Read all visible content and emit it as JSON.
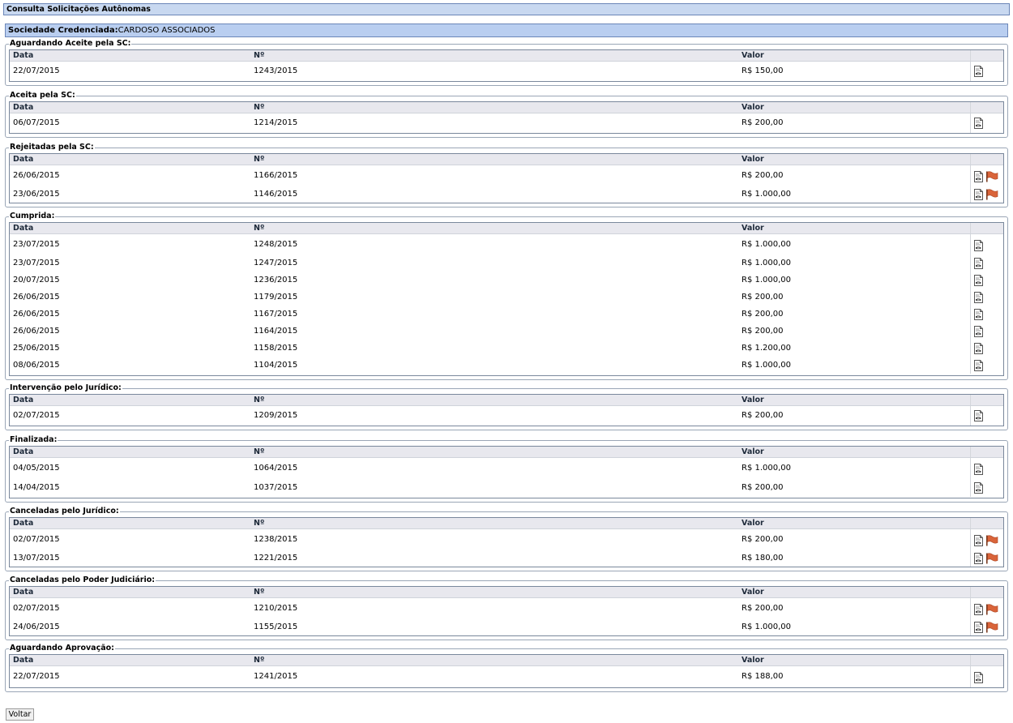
{
  "page": {
    "title": "Consulta Solicitações Autônomas",
    "sc_label": "Sociedade Credenciada:",
    "sc_value": "CARDOSO ASSOCIADOS",
    "back_button": "Voltar"
  },
  "columns": {
    "data": "Data",
    "numero": "Nº",
    "valor": "Valor"
  },
  "sections": [
    {
      "title": "Aguardando Aceite pela SC:",
      "rows": [
        {
          "data": "22/07/2015",
          "numero": "1243/2015",
          "valor": "R$ 150,00",
          "flag": false
        }
      ]
    },
    {
      "title": "Aceita pela SC:",
      "rows": [
        {
          "data": "06/07/2015",
          "numero": "1214/2015",
          "valor": "R$ 200,00",
          "flag": false
        }
      ]
    },
    {
      "title": "Rejeitadas pela SC:",
      "rows": [
        {
          "data": "26/06/2015",
          "numero": "1166/2015",
          "valor": "R$ 200,00",
          "flag": true
        },
        {
          "data": "23/06/2015",
          "numero": "1146/2015",
          "valor": "R$ 1.000,00",
          "flag": true
        }
      ]
    },
    {
      "title": "Cumprida:",
      "rows": [
        {
          "data": "23/07/2015",
          "numero": "1248/2015",
          "valor": "R$ 1.000,00",
          "flag": false
        },
        {
          "data": "23/07/2015",
          "numero": "1247/2015",
          "valor": "R$ 1.000,00",
          "flag": false
        },
        {
          "data": "20/07/2015",
          "numero": "1236/2015",
          "valor": "R$ 1.000,00",
          "flag": false
        },
        {
          "data": "26/06/2015",
          "numero": "1179/2015",
          "valor": "R$ 200,00",
          "flag": false
        },
        {
          "data": "26/06/2015",
          "numero": "1167/2015",
          "valor": "R$ 200,00",
          "flag": false
        },
        {
          "data": "26/06/2015",
          "numero": "1164/2015",
          "valor": "R$ 200,00",
          "flag": false
        },
        {
          "data": "25/06/2015",
          "numero": "1158/2015",
          "valor": "R$ 1.200,00",
          "flag": false
        },
        {
          "data": "08/06/2015",
          "numero": "1104/2015",
          "valor": "R$ 1.000,00",
          "flag": false
        }
      ]
    },
    {
      "title": "Intervenção pelo Jurídico:",
      "rows": [
        {
          "data": "02/07/2015",
          "numero": "1209/2015",
          "valor": "R$ 200,00",
          "flag": false
        }
      ]
    },
    {
      "title": "Finalizada:",
      "rows": [
        {
          "data": "04/05/2015",
          "numero": "1064/2015",
          "valor": "R$ 1.000,00",
          "flag": false
        },
        {
          "data": "14/04/2015",
          "numero": "1037/2015",
          "valor": "R$ 200,00",
          "flag": false
        }
      ]
    },
    {
      "title": "Canceladas pelo Jurídico:",
      "rows": [
        {
          "data": "02/07/2015",
          "numero": "1238/2015",
          "valor": "R$ 200,00",
          "flag": true
        },
        {
          "data": "13/07/2015",
          "numero": "1221/2015",
          "valor": "R$ 180,00",
          "flag": true
        }
      ]
    },
    {
      "title": "Canceladas pelo Poder Judiciário:",
      "rows": [
        {
          "data": "02/07/2015",
          "numero": "1210/2015",
          "valor": "R$ 200,00",
          "flag": true
        },
        {
          "data": "24/06/2015",
          "numero": "1155/2015",
          "valor": "R$ 1.000,00",
          "flag": true
        }
      ]
    },
    {
      "title": "Aguardando Aprovação:",
      "rows": [
        {
          "data": "22/07/2015",
          "numero": "1241/2015",
          "valor": "R$ 188,00",
          "flag": false
        }
      ]
    }
  ],
  "icons": {
    "view": "document-view-icon",
    "flag": "flag-icon"
  },
  "colors": {
    "title_bg": "#c8d8f0",
    "sc_bg": "#b9cef0",
    "flag": "#d9643a"
  }
}
